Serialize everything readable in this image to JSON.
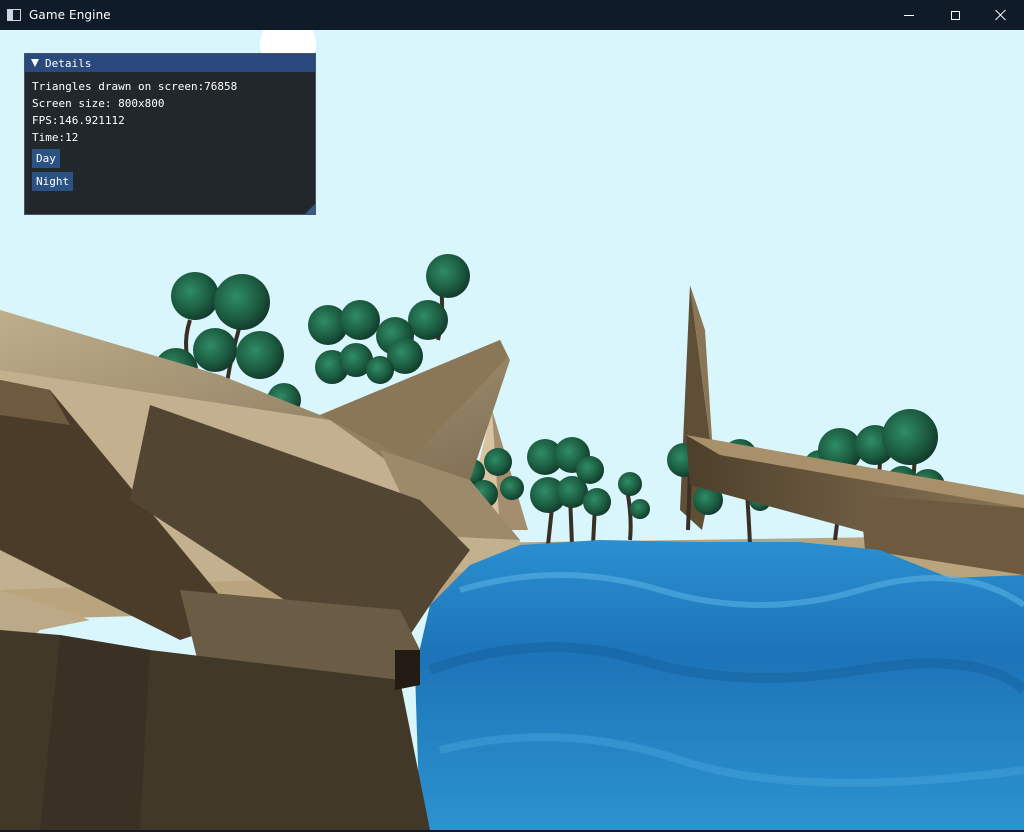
{
  "window": {
    "title": "Game Engine",
    "icon": "app-window-icon",
    "controls": {
      "minimize": "minimize-icon",
      "maximize": "maximize-icon",
      "close": "close-icon"
    }
  },
  "details_panel": {
    "header": "Details",
    "collapse_icon": "triangle-down-icon",
    "stats": [
      "Triangles drawn on screen:76858",
      "Screen size: 800x800",
      "FPS:146.921112",
      "Time:12"
    ],
    "buttons": {
      "day": "Day",
      "night": "Night"
    }
  },
  "scene": {
    "sky_color": "#d8f6fb",
    "water_color": "#1f7fc4",
    "rock_color": "#a89673",
    "foliage_color": "#1e6a4a"
  }
}
